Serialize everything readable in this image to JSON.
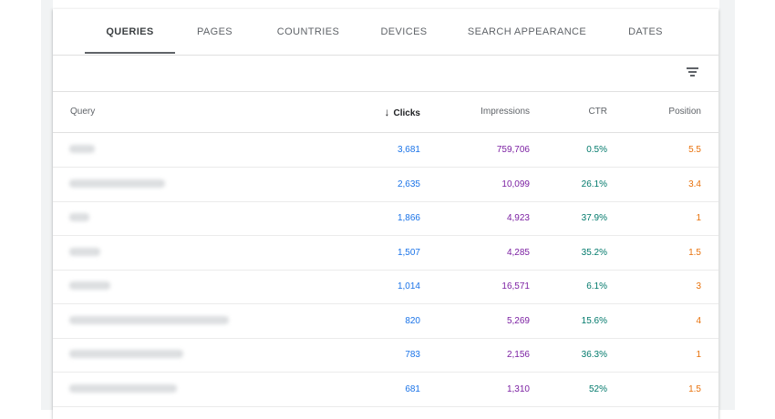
{
  "tabs": [
    "QUERIES",
    "PAGES",
    "COUNTRIES",
    "DEVICES",
    "SEARCH APPEARANCE",
    "DATES"
  ],
  "columns": {
    "query": "Query",
    "clicks": "Clicks",
    "impressions": "Impressions",
    "ctr": "CTR",
    "position": "Position"
  },
  "colors": {
    "clicks": "#1a73e8",
    "impressions": "#7b1fa2",
    "ctr": "#00796b",
    "position": "#e8710a"
  },
  "rows": [
    {
      "clicks": "3,681",
      "impressions": "759,706",
      "ctr": "0.5%",
      "position": "5.5"
    },
    {
      "clicks": "2,635",
      "impressions": "10,099",
      "ctr": "26.1%",
      "position": "3.4"
    },
    {
      "clicks": "1,866",
      "impressions": "4,923",
      "ctr": "37.9%",
      "position": "1"
    },
    {
      "clicks": "1,507",
      "impressions": "4,285",
      "ctr": "35.2%",
      "position": "1.5"
    },
    {
      "clicks": "1,014",
      "impressions": "16,571",
      "ctr": "6.1%",
      "position": "3"
    },
    {
      "clicks": "820",
      "impressions": "5,269",
      "ctr": "15.6%",
      "position": "4"
    },
    {
      "clicks": "783",
      "impressions": "2,156",
      "ctr": "36.3%",
      "position": "1"
    },
    {
      "clicks": "681",
      "impressions": "1,310",
      "ctr": "52%",
      "position": "1.5"
    }
  ]
}
